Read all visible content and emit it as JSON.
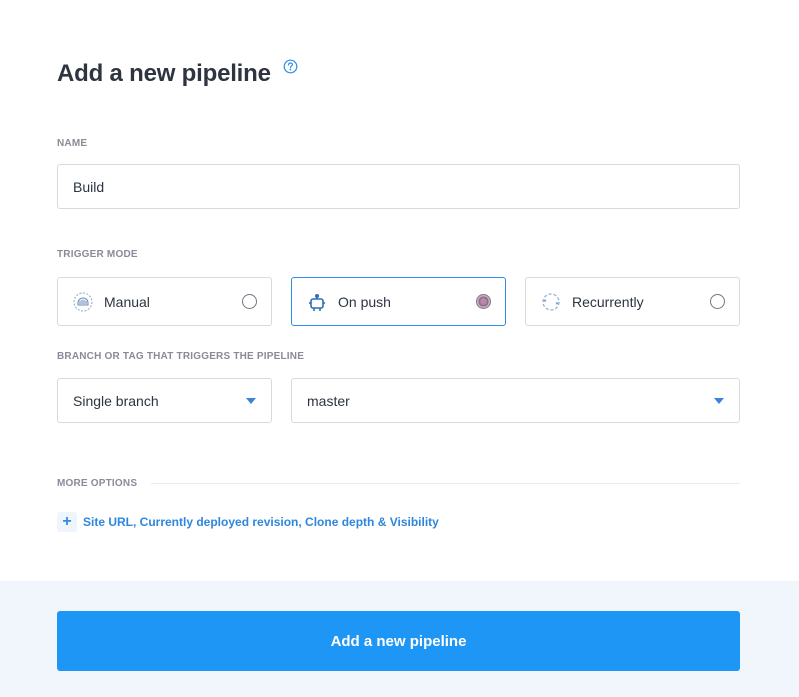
{
  "header": {
    "title": "Add a new pipeline",
    "help_icon": "question-circle-icon"
  },
  "name_field": {
    "label": "NAME",
    "value": "Build"
  },
  "trigger_mode": {
    "label": "TRIGGER MODE",
    "options": [
      {
        "label": "Manual",
        "icon": "manual-hand-icon",
        "selected": false
      },
      {
        "label": "On push",
        "icon": "robot-push-icon",
        "selected": true
      },
      {
        "label": "Recurrently",
        "icon": "recurring-cycle-icon",
        "selected": false
      }
    ]
  },
  "branch": {
    "label": "BRANCH OR TAG THAT TRIGGERS THE PIPELINE",
    "mode_value": "Single branch",
    "branch_value": "master"
  },
  "more_options": {
    "label": "MORE OPTIONS",
    "expand_label": "Site URL, Currently deployed revision, Clone depth & Visibility"
  },
  "submit": {
    "label": "Add a new pipeline"
  },
  "colors": {
    "accent": "#1e96f5",
    "selected_border": "#2e8ce8",
    "footer_bg": "#f0f6fc"
  }
}
